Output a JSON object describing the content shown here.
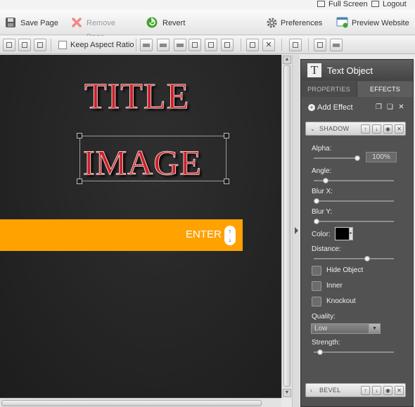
{
  "topbar": {
    "fullscreen_label": "Full Screen",
    "logout_label": "Logout"
  },
  "toolbar": {
    "save_label": "Save Page",
    "remove_label": "Remove Page",
    "revert_label": "Revert",
    "preferences_label": "Preferences",
    "preview_label": "Preview Website"
  },
  "toolbar2": {
    "keep_aspect_label": "Keep Aspect Ratio",
    "keep_aspect_checked": false
  },
  "canvas": {
    "title_text": "TITLE",
    "image_text": "IMAGE",
    "enter_label": "ENTER",
    "enter_arrows": "↑\n↓",
    "accent_color": "#ffa200"
  },
  "panel": {
    "title": "Text Object",
    "title_icon": "T",
    "tabs": [
      {
        "label": "PROPERTIES"
      },
      {
        "label": "EFFECTS"
      }
    ],
    "active_tab": "EFFECTS",
    "add_effect_label": "Add Effect",
    "shadow": {
      "title": "SHADOW",
      "labels": {
        "alpha": "Alpha:",
        "angle": "Angle:",
        "blur_x": "Blur X:",
        "blur_y": "Blur Y:",
        "color": "Color:",
        "distance": "Distance:",
        "quality": "Quality:",
        "strength": "Strength:"
      },
      "alpha_value": "100%",
      "color_value": "#000000",
      "slider_levels": {
        "alpha": 1.0,
        "angle": 0.12,
        "blur_x": 0.0,
        "blur_y": 0.0,
        "distance": 0.68,
        "strength": 0.05
      },
      "checkboxes": [
        {
          "label": "Hide Object",
          "checked": false
        },
        {
          "label": "Inner",
          "checked": false
        },
        {
          "label": "Knockout",
          "checked": false
        }
      ],
      "quality_value": "Low"
    },
    "bevel": {
      "title": "BEVEL"
    }
  }
}
